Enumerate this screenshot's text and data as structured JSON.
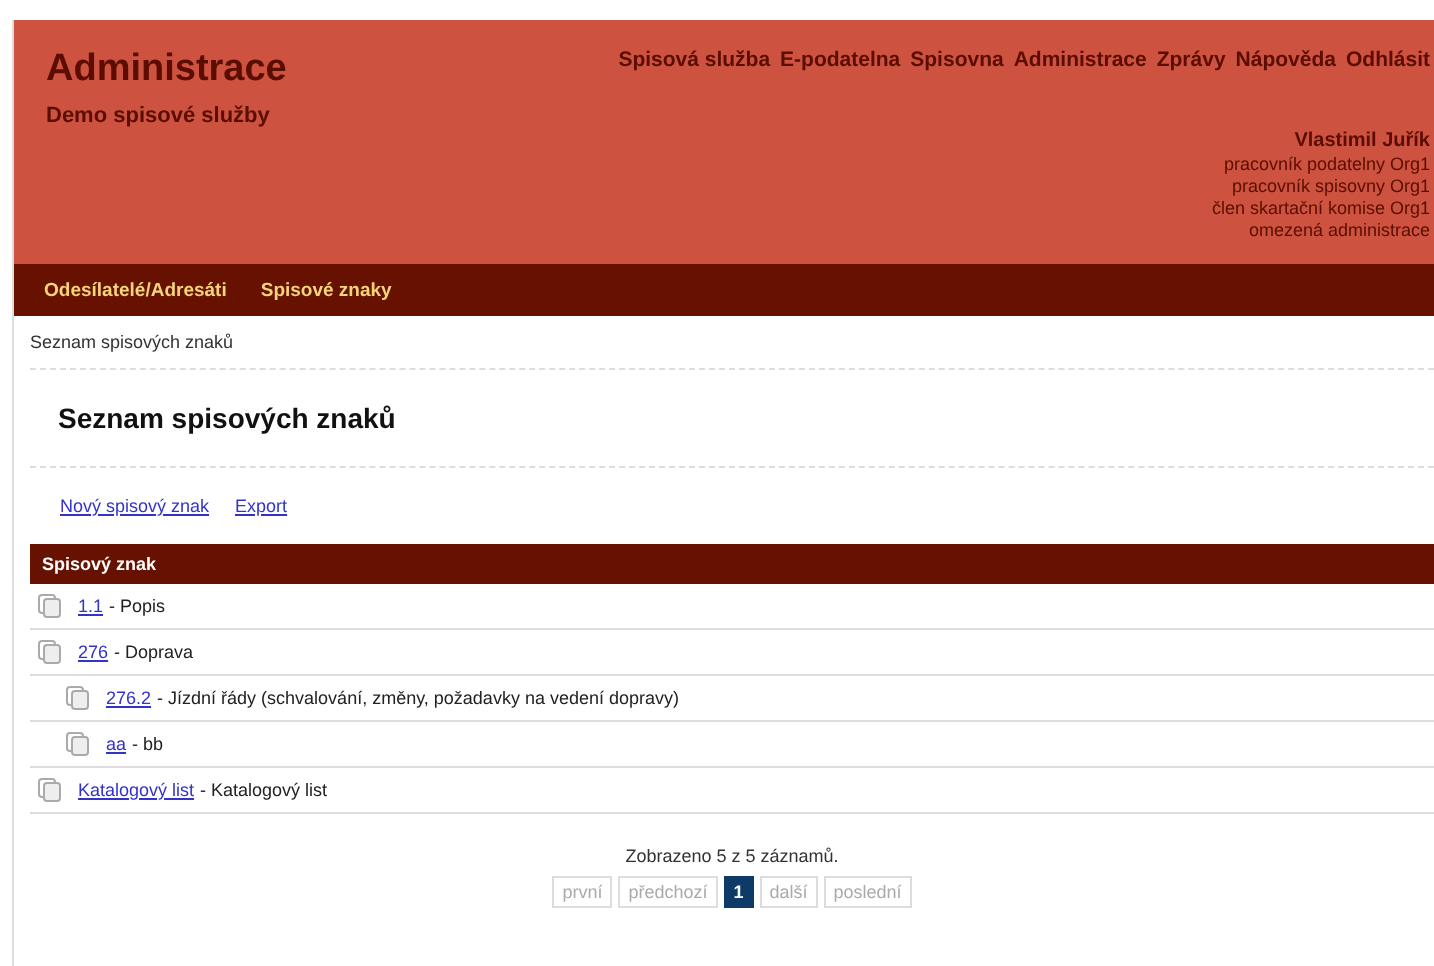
{
  "header": {
    "title": "Administrace",
    "subtitle": "Demo spisové služby",
    "menu": [
      "Spisová služba",
      "E-podatelna",
      "Spisovna",
      "Administrace",
      "Zprávy",
      "Nápověda",
      "Odhlásit"
    ],
    "user": {
      "name": "Vlastimil Juřík",
      "roles": [
        "pracovník podatelny Org1",
        "pracovník spisovny Org1",
        "člen skartační komise Org1",
        "omezená administrace"
      ]
    }
  },
  "submenu": [
    "Odesílatelé/Adresáti",
    "Spisové znaky"
  ],
  "breadcrumb": "Seznam spisových znaků",
  "heading": "Seznam spisových znaků",
  "actions": [
    "Nový spisový znak",
    "Export"
  ],
  "table": {
    "columns": [
      "Spisový znak"
    ],
    "rows": [
      {
        "code": "1.1",
        "text": "- Popis"
      },
      {
        "code": "276",
        "text": "- Doprava",
        "children": [
          {
            "code": "276.2",
            "text": "- Jízdní řády (schvalování, změny, požadavky na vedení dopravy)"
          },
          {
            "code": "aa",
            "text": "- bb"
          }
        ]
      },
      {
        "code": "Katalogový list",
        "text": "- Katalogový list"
      }
    ]
  },
  "summary": "Zobrazeno 5 z 5 záznamů.",
  "pager": [
    {
      "label": "první",
      "selected": false,
      "disabled": true
    },
    {
      "label": "předchozí",
      "selected": false,
      "disabled": true
    },
    {
      "label": "1",
      "selected": true,
      "disabled": false
    },
    {
      "label": "další",
      "selected": false,
      "disabled": true
    },
    {
      "label": "poslední",
      "selected": false,
      "disabled": true
    }
  ]
}
